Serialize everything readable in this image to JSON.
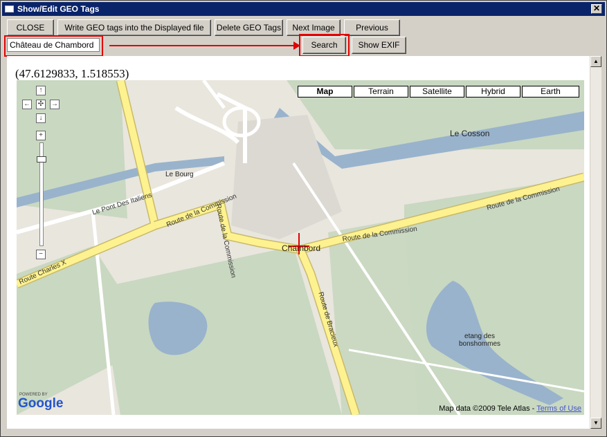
{
  "window": {
    "title": "Show/Edit GEO Tags",
    "close_glyph": "✕"
  },
  "toolbar": {
    "close": "CLOSE",
    "write": "Write GEO tags into the Displayed file",
    "delete": "Delete GEO Tags",
    "next": "Next Image",
    "previous": "Previous Image",
    "search": "Search",
    "show_exif": "Show EXIF"
  },
  "search": {
    "value": "Château de Chambord"
  },
  "coordinates": "(47.6129833, 1.518553)",
  "map": {
    "types": [
      "Map",
      "Terrain",
      "Satellite",
      "Hybrid",
      "Earth"
    ],
    "active_type": "Map",
    "labels": {
      "cosson": "Le Cosson",
      "bourg": "Le Bourg",
      "pont": "Le Pont Des Italiens",
      "route_commission_1": "Route de la Commission",
      "route_commission_2": "Route de la Commission",
      "route_commission_3": "Route de la Commission",
      "route_charles": "Route Charles X",
      "route_bracieux": "Route de Bracieux",
      "chambord": "Chambord",
      "etang": "etang des bonshommes"
    },
    "powered_by": "POWERED BY",
    "google": "Google",
    "copyright": "Map data ©2009 Tele Atlas -",
    "terms": "Terms of Use",
    "nav": {
      "up": "↑",
      "left": "←",
      "center": "✣",
      "right": "→",
      "down": "↓",
      "zoom_in": "+",
      "zoom_out": "−"
    }
  },
  "colors": {
    "title_bar": "#0a246a",
    "highlight": "#e00000",
    "water": "#99b3cc",
    "road_major": "#fdf28f",
    "park": "#c9d8c1"
  }
}
